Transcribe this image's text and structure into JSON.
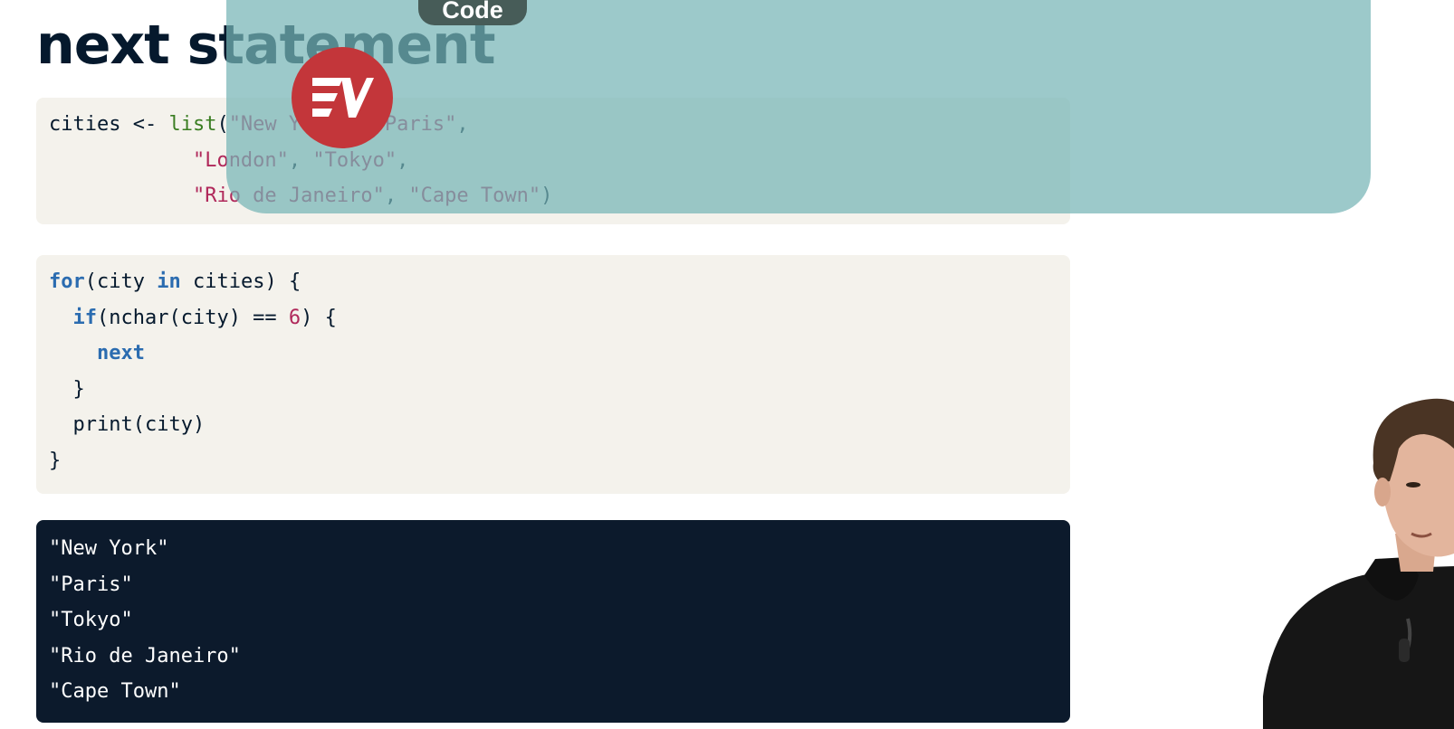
{
  "slide": {
    "title": "next statement"
  },
  "code_block_1": {
    "lines": [
      [
        {
          "t": "cities <- ",
          "c": "plain"
        },
        {
          "t": "list",
          "c": "fn"
        },
        {
          "t": "(",
          "c": "plain"
        },
        {
          "t": "\"New York\"",
          "c": "str"
        },
        {
          "t": ", ",
          "c": "plain"
        },
        {
          "t": "\"Paris\"",
          "c": "str"
        },
        {
          "t": ",",
          "c": "plain"
        }
      ],
      [
        {
          "t": "            ",
          "c": "plain"
        },
        {
          "t": "\"London\"",
          "c": "str"
        },
        {
          "t": ", ",
          "c": "plain"
        },
        {
          "t": "\"Tokyo\"",
          "c": "str"
        },
        {
          "t": ",",
          "c": "plain"
        }
      ],
      [
        {
          "t": "            ",
          "c": "plain"
        },
        {
          "t": "\"Rio de Janeiro\"",
          "c": "str"
        },
        {
          "t": ", ",
          "c": "plain"
        },
        {
          "t": "\"Cape Town\"",
          "c": "str"
        },
        {
          "t": ")",
          "c": "plain"
        }
      ]
    ]
  },
  "code_block_2": {
    "lines": [
      [
        {
          "t": "for",
          "c": "kw"
        },
        {
          "t": "(city ",
          "c": "plain"
        },
        {
          "t": "in",
          "c": "kw"
        },
        {
          "t": " cities) {",
          "c": "plain"
        }
      ],
      [
        {
          "t": "  ",
          "c": "plain"
        },
        {
          "t": "if",
          "c": "kw"
        },
        {
          "t": "(nchar(city) == ",
          "c": "plain"
        },
        {
          "t": "6",
          "c": "num"
        },
        {
          "t": ") {",
          "c": "plain"
        }
      ],
      [
        {
          "t": "    ",
          "c": "plain"
        },
        {
          "t": "next",
          "c": "kw"
        }
      ],
      [
        {
          "t": "  }",
          "c": "plain"
        }
      ],
      [
        {
          "t": "  print(city)",
          "c": "plain"
        }
      ],
      [
        {
          "t": "}",
          "c": "plain"
        }
      ]
    ]
  },
  "output": {
    "lines": [
      "\"New York\"",
      "\"Paris\"",
      "\"Tokyo\"",
      "\"Rio de Janeiro\"",
      "\"Cape Town\""
    ]
  },
  "overlay": {
    "tab_label": "Code",
    "panel_color": "#76b4b6"
  },
  "vpn_logo": {
    "icon": "expressvpn-logo-icon",
    "color": "#c3363a"
  },
  "colors": {
    "title": "#05192d",
    "code_bg": "#f4f2ec",
    "output_bg": "#0c1a2c",
    "keyword": "#2b6cb0",
    "function": "#3a7d22",
    "string": "#b0285a"
  }
}
